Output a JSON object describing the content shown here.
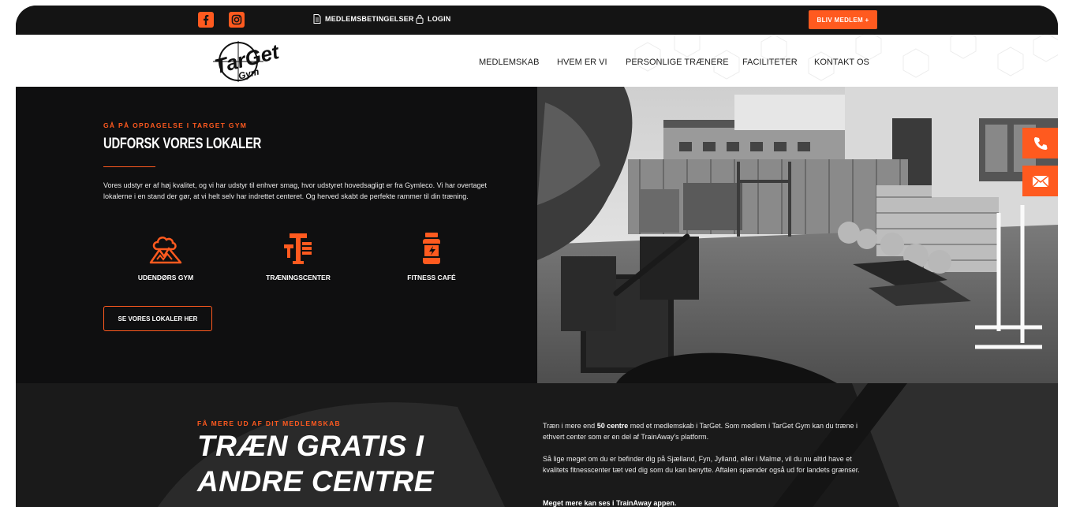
{
  "topbar": {
    "facebook_icon": "facebook-icon",
    "instagram_icon": "instagram-icon",
    "terms_link": "MEDLEMSBETINGELSER",
    "login_link": "LOGIN",
    "join_button": "BLIV MEDLEM +"
  },
  "logo": {
    "text_top": "TarGet",
    "text_bottom": "Gym"
  },
  "nav": {
    "items": [
      "MEDLEMSKAB",
      "HVEM ER VI",
      "PERSONLIGE TRÆNERE",
      "FACILITETER",
      "KONTAKT OS"
    ]
  },
  "hero": {
    "eyebrow": "GÅ PÅ OPDAGELSE I TARGET GYM",
    "title": "UDFORSK VORES LOKALER",
    "description": "Vores udstyr er af høj kvalitet, og vi har udstyr til enhver smag, hvor udstyret hovedsagligt er fra Gymleco. Vi har overtaget lokalerne i en stand der gør, at vi helt selv har indrettet centeret. Og herved skabt de perfekte rammer til din træning.",
    "features": [
      {
        "label": "UDENDØRS GYM",
        "icon": "mountain-cloud-icon"
      },
      {
        "label": "TRÆNINGSCENTER",
        "icon": "gym-station-icon"
      },
      {
        "label": "FITNESS CAFÉ",
        "icon": "supplement-jar-icon"
      }
    ],
    "cta": "SE VORES LOKALER HER"
  },
  "side_actions": {
    "phone_icon": "phone-icon",
    "mail_icon": "mail-icon"
  },
  "bottom": {
    "eyebrow": "FÅ MERE UD AF DIT MEDLEMSKAB",
    "title_line1": "TRÆN GRATIS I",
    "title_line2": "ANDRE CENTRE",
    "p1_pre": "Træn i mere end ",
    "p1_bold": "50 centre",
    "p1_post": " med et medlemskab i TarGet. Som medlem i TarGet Gym kan du træne i ethvert center som er en del af TrainAway's platform.",
    "p2": "Så lige meget om du er befinder dig på Sjælland, Fyn, Jylland, eller i Malmø, vil du nu altid have et kvalitets fitnesscenter tæt ved dig som du kan benytte. Aftalen spænder også ud for landets grænser.",
    "p3": "Meget mere kan ses i TrainAway appen."
  },
  "colors": {
    "accent": "#ff5a1f",
    "dark": "#0f0f10",
    "topbar": "#141414"
  }
}
